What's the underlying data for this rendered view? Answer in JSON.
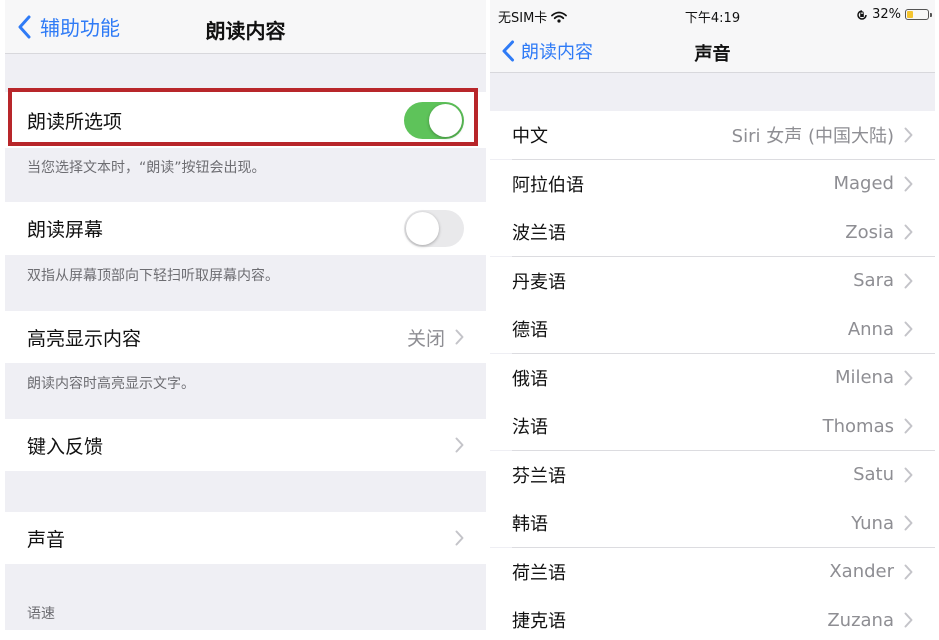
{
  "left": {
    "back_label": "辅助功能",
    "title": "朗读内容",
    "speak_selection": {
      "label": "朗读所选项",
      "enabled": true,
      "footer": "当您选择文本时，“朗读”按钮会出现。"
    },
    "speak_screen": {
      "label": "朗读屏幕",
      "enabled": false,
      "footer": "双指从屏幕顶部向下轻扫听取屏幕内容。"
    },
    "highlight": {
      "label": "高亮显示内容",
      "value": "关闭",
      "footer": "朗读内容时高亮显示文字。"
    },
    "typing_feedback": {
      "label": "键入反馈"
    },
    "voices": {
      "label": "声音"
    },
    "rate_header": "语速"
  },
  "status": {
    "carrier": "无SIM卡",
    "time": "下午4:19",
    "battery": "32%",
    "battery_level": 0.32
  },
  "right": {
    "back_label": "朗读内容",
    "title": "声音",
    "languages": [
      {
        "language": "中文",
        "voice": "Siri 女声 (中国大陆)"
      },
      {
        "language": "阿拉伯语",
        "voice": "Maged"
      },
      {
        "language": "波兰语",
        "voice": "Zosia"
      },
      {
        "language": "丹麦语",
        "voice": "Sara"
      },
      {
        "language": "德语",
        "voice": "Anna"
      },
      {
        "language": "俄语",
        "voice": "Milena"
      },
      {
        "language": "法语",
        "voice": "Thomas"
      },
      {
        "language": "芬兰语",
        "voice": "Satu"
      },
      {
        "language": "韩语",
        "voice": "Yuna"
      },
      {
        "language": "荷兰语",
        "voice": "Xander"
      },
      {
        "language": "捷克语",
        "voice": "Zuzana"
      }
    ]
  },
  "colors": {
    "accent": "#2f7bf6",
    "toggle_on": "#5ec35a",
    "highlight_border": "#b8262a",
    "group_background": "#efeff4"
  },
  "icons": [
    "chevron-left-icon",
    "chevron-right-icon",
    "wifi-icon",
    "orientation-lock-icon",
    "battery-icon"
  ]
}
